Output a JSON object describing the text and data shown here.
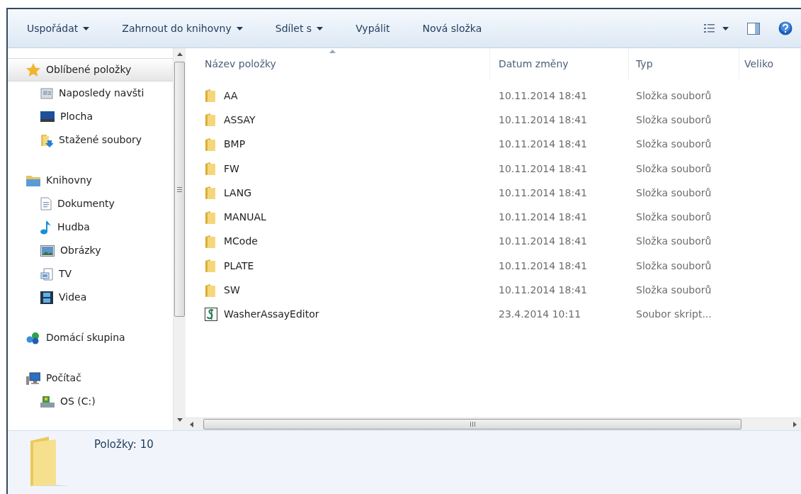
{
  "toolbar": {
    "buttons": [
      {
        "label": "Uspořádat",
        "dropdown": true
      },
      {
        "label": "Zahrnout do knihovny",
        "dropdown": true
      },
      {
        "label": "Sdílet s",
        "dropdown": true
      },
      {
        "label": "Vypálit",
        "dropdown": false
      },
      {
        "label": "Nová složka",
        "dropdown": false
      }
    ]
  },
  "navigation": {
    "groups": [
      {
        "label": "Oblíbené položky",
        "selected": true,
        "children": [
          {
            "label": "Naposledy navšti",
            "selected": false
          },
          {
            "label": "Plocha",
            "selected": false
          },
          {
            "label": "Stažené soubory",
            "selected": false
          }
        ]
      },
      {
        "label": "Knihovny",
        "selected": false,
        "children": [
          {
            "label": "Dokumenty",
            "selected": false
          },
          {
            "label": "Hudba",
            "selected": false
          },
          {
            "label": "Obrázky",
            "selected": false
          },
          {
            "label": "TV",
            "selected": false
          },
          {
            "label": "Videa",
            "selected": false
          }
        ]
      },
      {
        "label": "Domácí skupina",
        "selected": false
      },
      {
        "label": "Počítač",
        "selected": false,
        "children": [
          {
            "label": "OS (C:)",
            "selected": false
          }
        ]
      }
    ]
  },
  "file_list": {
    "columns": [
      "Název položky",
      "Datum změny",
      "Typ",
      "Veliko"
    ],
    "rows": [
      {
        "kind": "folder",
        "name": "AA",
        "date": "10.11.2014 18:41",
        "type": "Složka souborů"
      },
      {
        "kind": "folder",
        "name": "ASSAY",
        "date": "10.11.2014 18:41",
        "type": "Složka souborů"
      },
      {
        "kind": "folder",
        "name": "BMP",
        "date": "10.11.2014 18:41",
        "type": "Složka souborů"
      },
      {
        "kind": "folder",
        "name": "FW",
        "date": "10.11.2014 18:41",
        "type": "Složka souborů"
      },
      {
        "kind": "folder",
        "name": "LANG",
        "date": "10.11.2014 18:41",
        "type": "Složka souborů"
      },
      {
        "kind": "folder",
        "name": "MANUAL",
        "date": "10.11.2014 18:41",
        "type": "Složka souborů"
      },
      {
        "kind": "folder",
        "name": "MCode",
        "date": "10.11.2014 18:41",
        "type": "Složka souborů"
      },
      {
        "kind": "folder",
        "name": "PLATE",
        "date": "10.11.2014 18:41",
        "type": "Složka souborů"
      },
      {
        "kind": "folder",
        "name": "SW",
        "date": "10.11.2014 18:41",
        "type": "Složka souborů"
      },
      {
        "kind": "script",
        "name": "WasherAssayEditor",
        "date": "23.4.2014 10:11",
        "type": "Soubor skript..."
      }
    ]
  },
  "status_bar": {
    "text": "Položky: 10"
  }
}
